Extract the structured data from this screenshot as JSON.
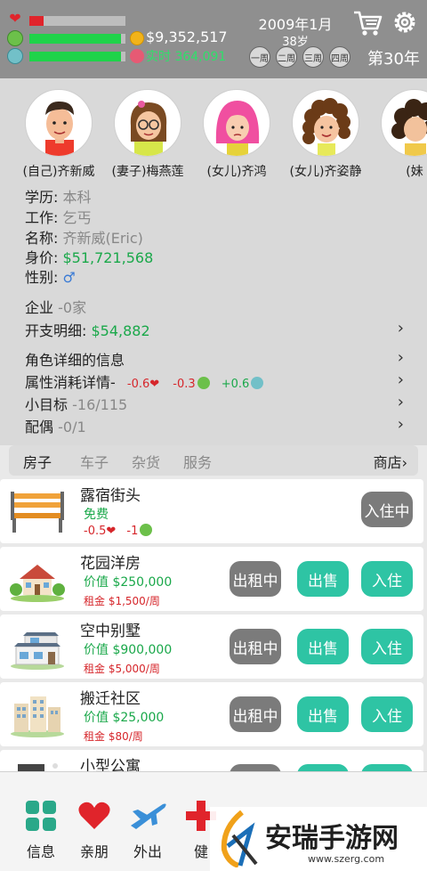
{
  "header": {
    "money": "$9,352,517",
    "stat3_text": "实时 364,091",
    "date": "2009年1月",
    "age": "38岁",
    "weeks": [
      "一周",
      "二周",
      "三周",
      "四周"
    ],
    "year": "第30年",
    "health_level": 0.15,
    "happiness_level": 0.95,
    "third_level": 0.95
  },
  "family": [
    {
      "name": "(自己)齐新威"
    },
    {
      "name": "(妻子)梅燕莲"
    },
    {
      "name": "(女儿)齐鸿"
    },
    {
      "name": "(女儿)齐姿静"
    },
    {
      "name": "(妹"
    }
  ],
  "profile": {
    "edu_label": "学历:",
    "edu": "本科",
    "job_label": "工作:",
    "job": "乞丐",
    "name_label": "名称:",
    "name": "齐新威(Eric)",
    "worth_label": "身价:",
    "worth": "$51,721,568",
    "gender_label": "性别:",
    "gender": "♂"
  },
  "menu": {
    "company_label": "企业",
    "company_val": "-0家",
    "expense_label": "开支明细:",
    "expense_val": "$54,882",
    "detail_label": "角色详细的信息",
    "attr_label": "属性消耗详情-",
    "attr1": "-0.6",
    "attr2": "-0.3",
    "attr3": "+0.6",
    "goal_label": "小目标",
    "goal_val": "-16/115",
    "spouse_label": "配偶",
    "spouse_val": "-0/1"
  },
  "tabs": [
    "房子",
    "车子",
    "杂货",
    "服务"
  ],
  "shop_label": "商店",
  "houses": [
    {
      "title": "露宿街头",
      "value": "免费",
      "cost1": "-0.5",
      "cost2": "-1",
      "button": "入住中"
    },
    {
      "title": "花园洋房",
      "value": "价值 $250,000",
      "rent": "租金 $1,500/周",
      "btn_rent": "出租中",
      "btn_sell": "出售",
      "btn_live": "入住"
    },
    {
      "title": "空中别墅",
      "value": "价值 $900,000",
      "rent": "租金 $5,000/周",
      "btn_rent": "出租中",
      "btn_sell": "出售",
      "btn_live": "入住"
    },
    {
      "title": "搬迁社区",
      "value": "价值 $25,000",
      "rent": "租金 $80/周",
      "btn_rent": "出租中",
      "btn_sell": "出售",
      "btn_live": "入住"
    },
    {
      "title": "小型公寓"
    }
  ],
  "nav": [
    {
      "label": "信息"
    },
    {
      "label": "亲朋"
    },
    {
      "label": "外出"
    },
    {
      "label": "健"
    }
  ],
  "watermark": {
    "text": "安瑞手游网",
    "url": "www.szerg.com"
  }
}
